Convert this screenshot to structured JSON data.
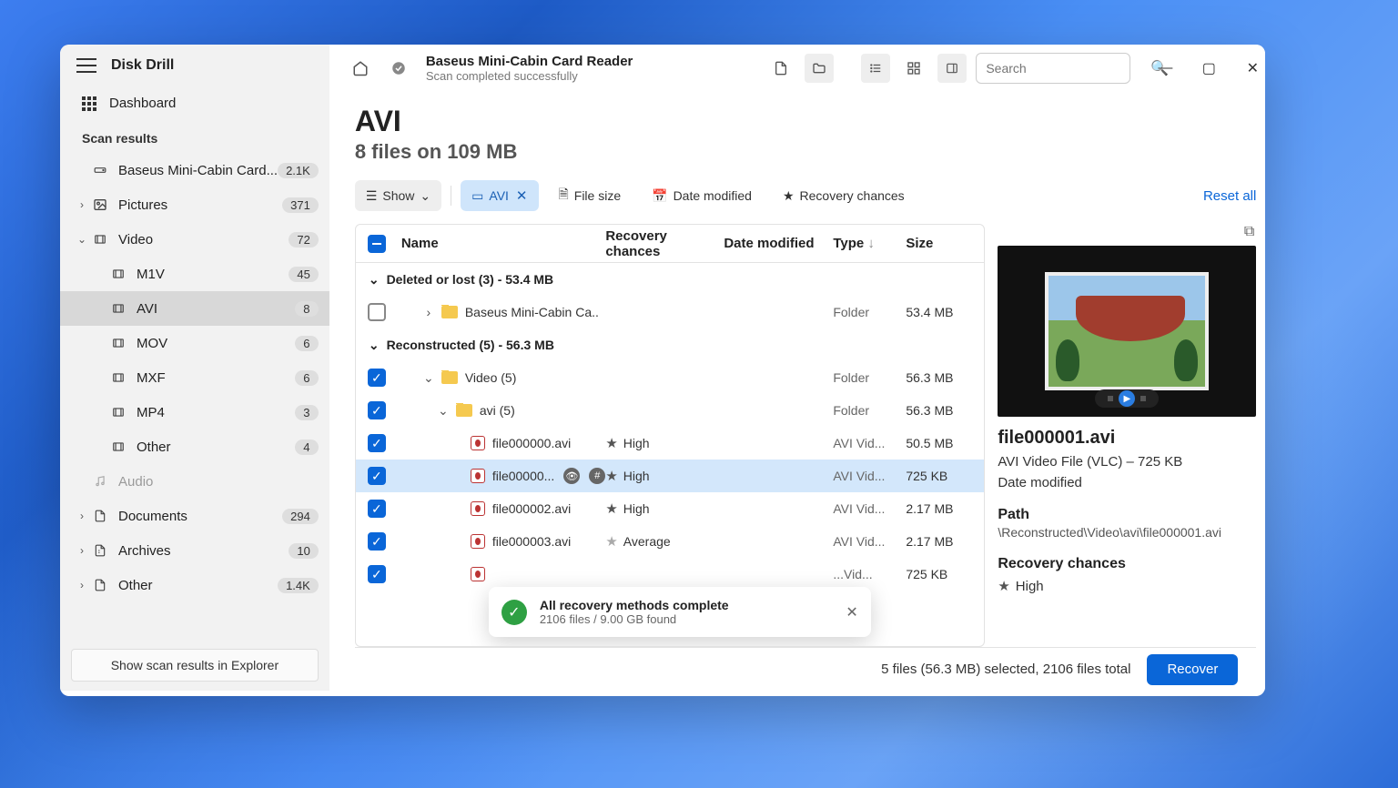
{
  "app": {
    "title": "Disk Drill"
  },
  "sidebar": {
    "dashboard": "Dashboard",
    "section": "Scan results",
    "items": [
      {
        "label": "Baseus Mini-Cabin Card...",
        "count": "2.1K",
        "icon": "drive",
        "pad": 0,
        "chev": ""
      },
      {
        "label": "Pictures",
        "count": "371",
        "icon": "picture",
        "pad": 0,
        "chev": "›"
      },
      {
        "label": "Video",
        "count": "72",
        "icon": "video",
        "pad": 0,
        "chev": "⌄"
      },
      {
        "label": "M1V",
        "count": "45",
        "icon": "video",
        "pad": 1,
        "chev": ""
      },
      {
        "label": "AVI",
        "count": "8",
        "icon": "video",
        "pad": 1,
        "chev": "",
        "active": true
      },
      {
        "label": "MOV",
        "count": "6",
        "icon": "video",
        "pad": 1,
        "chev": ""
      },
      {
        "label": "MXF",
        "count": "6",
        "icon": "video",
        "pad": 1,
        "chev": ""
      },
      {
        "label": "MP4",
        "count": "3",
        "icon": "video",
        "pad": 1,
        "chev": ""
      },
      {
        "label": "Other",
        "count": "4",
        "icon": "video",
        "pad": 1,
        "chev": ""
      },
      {
        "label": "Audio",
        "count": "",
        "icon": "audio",
        "pad": 0,
        "chev": "",
        "muted": true
      },
      {
        "label": "Documents",
        "count": "294",
        "icon": "document",
        "pad": 0,
        "chev": "›"
      },
      {
        "label": "Archives",
        "count": "10",
        "icon": "archive",
        "pad": 0,
        "chev": "›"
      },
      {
        "label": "Other",
        "count": "1.4K",
        "icon": "other",
        "pad": 0,
        "chev": "›"
      }
    ],
    "footer_btn": "Show scan results in Explorer"
  },
  "titlebar": {
    "title": "Baseus Mini-Cabin Card Reader",
    "subtitle": "Scan completed successfully",
    "search_placeholder": "Search"
  },
  "header": {
    "title": "AVI",
    "subtitle": "8 files on 109 MB"
  },
  "filters": {
    "show": "Show",
    "avi": "AVI",
    "filesize": "File size",
    "date": "Date modified",
    "recovery": "Recovery chances",
    "reset": "Reset all"
  },
  "columns": {
    "name": "Name",
    "recovery": "Recovery chances",
    "date": "Date modified",
    "type": "Type",
    "size": "Size"
  },
  "groups": [
    {
      "label": "Deleted or lost (3) - 53.4 MB"
    },
    {
      "label": "Reconstructed (5) - 56.3 MB"
    }
  ],
  "rows": [
    {
      "grp": 0,
      "cb": "empty",
      "indent": 1,
      "chev": "›",
      "icon": "folder",
      "name": "Baseus Mini-Cabin Ca..",
      "rec": "",
      "type": "Folder",
      "size": "53.4 MB"
    },
    {
      "grp": 1,
      "cb": "checked",
      "indent": 1,
      "chev": "⌄",
      "icon": "folder",
      "name": "Video (5)",
      "rec": "",
      "type": "Folder",
      "size": "56.3 MB"
    },
    {
      "grp": 1,
      "cb": "checked",
      "indent": 2,
      "chev": "⌄",
      "icon": "folder",
      "name": "avi (5)",
      "rec": "",
      "type": "Folder",
      "size": "56.3 MB"
    },
    {
      "grp": 1,
      "cb": "checked",
      "indent": 3,
      "chev": "",
      "icon": "vid",
      "name": "file000000.avi",
      "rec": "High",
      "star": "full",
      "type": "AVI Vid...",
      "size": "50.5 MB"
    },
    {
      "grp": 1,
      "cb": "checked",
      "indent": 3,
      "chev": "",
      "icon": "vid",
      "name": "file00000...",
      "rec": "High",
      "star": "full",
      "type": "AVI Vid...",
      "size": "725 KB",
      "sel": true,
      "pills": true
    },
    {
      "grp": 1,
      "cb": "checked",
      "indent": 3,
      "chev": "",
      "icon": "vid",
      "name": "file000002.avi",
      "rec": "High",
      "star": "full",
      "type": "AVI Vid...",
      "size": "2.17 MB"
    },
    {
      "grp": 1,
      "cb": "checked",
      "indent": 3,
      "chev": "",
      "icon": "vid",
      "name": "file000003.avi",
      "rec": "Average",
      "star": "gray",
      "type": "AVI Vid...",
      "size": "2.17 MB"
    },
    {
      "grp": 1,
      "cb": "checked",
      "indent": 3,
      "chev": "",
      "icon": "vid",
      "name": "",
      "rec": "",
      "star": "",
      "type": "...Vid...",
      "size": "725 KB"
    }
  ],
  "preview": {
    "name": "file000001.avi",
    "meta": "AVI Video File (VLC) – 725 KB",
    "date_label": "Date modified",
    "path_label": "Path",
    "path": "\\Reconstructed\\Video\\avi\\file000001.avi",
    "rec_label": "Recovery chances",
    "rec_value": "High"
  },
  "toast": {
    "title": "All recovery methods complete",
    "subtitle": "2106 files / 9.00 GB found"
  },
  "footer": {
    "status": "5 files (56.3 MB) selected, 2106 files total",
    "recover": "Recover"
  }
}
